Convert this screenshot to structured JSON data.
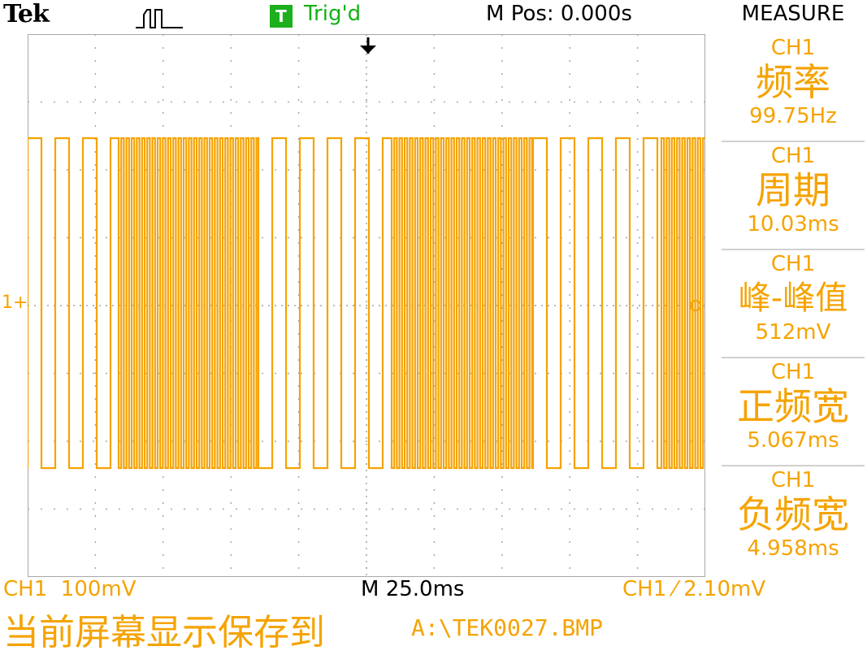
{
  "header": {
    "brand": "Tek",
    "trigger_badge": "T",
    "trigger_status": "Trig'd",
    "m_pos": "M Pos: 0.000s",
    "menu_title": "MEASURE",
    "trigger_mode_icon": "pulse-icon"
  },
  "screen": {
    "channel_marker": "1+",
    "trace_color": "#f5a300",
    "grid_color": "#a8a8a8",
    "trigger_position_icon": "down-arrow-icon"
  },
  "measurements": [
    {
      "channel": "CH1",
      "name": "频率",
      "value": "99.75Hz"
    },
    {
      "channel": "CH1",
      "name": "周期",
      "value": "10.03ms"
    },
    {
      "channel": "CH1",
      "name": "峰-峰值",
      "value": "512mV"
    },
    {
      "channel": "CH1",
      "name": "正频宽",
      "value": "5.067ms"
    },
    {
      "channel": "CH1",
      "name": "负频宽",
      "value": "4.958ms"
    }
  ],
  "footer": {
    "ch1_scale": "CH1  100mV",
    "timebase": "M 25.0ms",
    "trigger_level": "CH1 ⁄ 2.10mV",
    "save_message": "当前屏幕显示保存到",
    "save_path": "A:\\TEK0027.BMP"
  }
}
